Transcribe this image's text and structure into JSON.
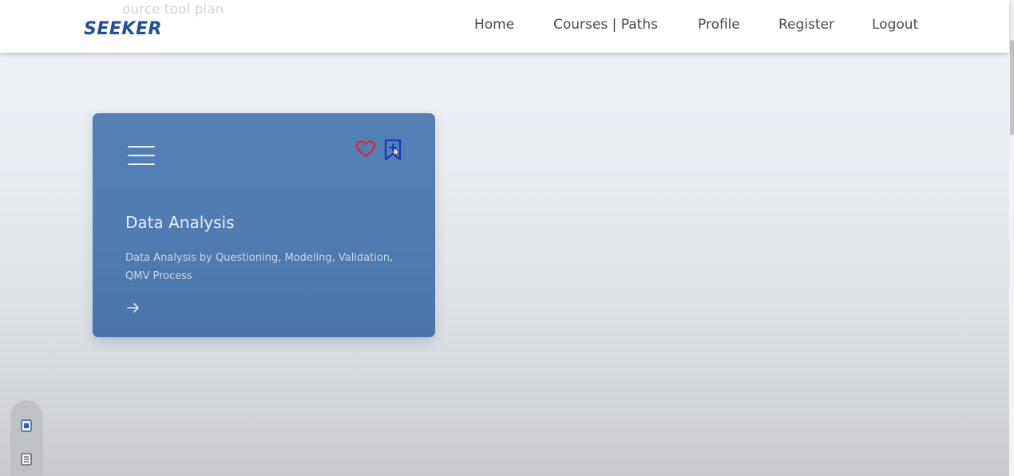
{
  "header": {
    "ghost_text": "ource tool plan",
    "logo": "SEEKER",
    "nav": {
      "home": "Home",
      "courses_paths": "Courses | Paths",
      "profile": "Profile",
      "register": "Register",
      "logout": "Logout"
    }
  },
  "card": {
    "title": "Data Analysis",
    "description": "Data Analysis by Questioning, Modeling, Validation, QMV Process",
    "icons": {
      "menu": "hamburger-menu-icon",
      "favorite": "heart-icon",
      "bookmark": "bookmark-add-icon",
      "open": "arrow-right-icon"
    }
  },
  "side_widget": {
    "icons": [
      "document-icon",
      "notes-list-icon"
    ]
  },
  "colors": {
    "brand": "#1d4f9c",
    "card_bg": "#5080b5",
    "heart": "#d8253c",
    "bookmark": "#1a35c8",
    "header_bg": "#ffffff",
    "nav_text": "#4a4a4a"
  }
}
